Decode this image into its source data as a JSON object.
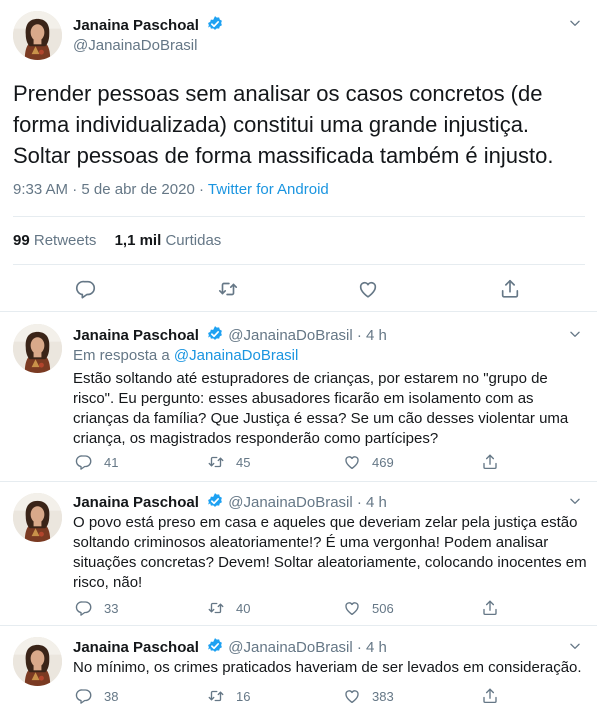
{
  "main_tweet": {
    "display_name": "Janaina Paschoal",
    "handle": "@JanainaDoBrasil",
    "text": "Prender pessoas sem analisar os casos concretos (de forma individualizada) constitui uma grande injustiça. Soltar pessoas de forma massificada também é injusto.",
    "time": "9:33 AM · 5 de abr de 2020 · ",
    "source": "Twitter for Android",
    "retweets_count": "99",
    "retweets_label": "Retweets",
    "likes_count": "1,1 mil",
    "likes_label": "Curtidas"
  },
  "replies": [
    {
      "display_name": "Janaina Paschoal",
      "handle_time": "@JanainaDoBrasil · 4 h",
      "in_reply_prefix": "Em resposta a ",
      "in_reply_handle": "@JanainaDoBrasil",
      "text": "Estão soltando até estupradores de crianças, por estarem no \"grupo de risco\". Eu pergunto: esses abusadores ficarão em isolamento com as crianças da família? Que Justiça é essa? Se um cão desses violentar uma criança, os magistrados responderão como partícipes?",
      "replies": "41",
      "retweets": "45",
      "likes": "469"
    },
    {
      "display_name": "Janaina Paschoal",
      "handle_time": "@JanainaDoBrasil · 4 h",
      "text": "O povo está preso em casa e aqueles que deveriam zelar pela justiça estão soltando criminosos aleatoriamente!? É uma vergonha! Podem analisar situações concretas? Devem! Soltar aleatoriamente, colocando inocentes em risco, não!",
      "replies": "33",
      "retweets": "40",
      "likes": "506"
    },
    {
      "display_name": "Janaina Paschoal",
      "handle_time": "@JanainaDoBrasil · 4 h",
      "text": "No mínimo, os crimes praticados haveriam de ser levados em consideração.",
      "replies": "38",
      "retweets": "16",
      "likes": "383"
    }
  ],
  "colors": {
    "accent": "#1da1f2",
    "link": "#1b95e0",
    "secondary_text": "#657786",
    "primary_text": "#14171a",
    "divider": "#e6ecf0"
  },
  "icons": [
    "verified-badge-icon",
    "chevron-down-icon",
    "reply-icon",
    "retweet-icon",
    "like-icon",
    "share-icon"
  ]
}
